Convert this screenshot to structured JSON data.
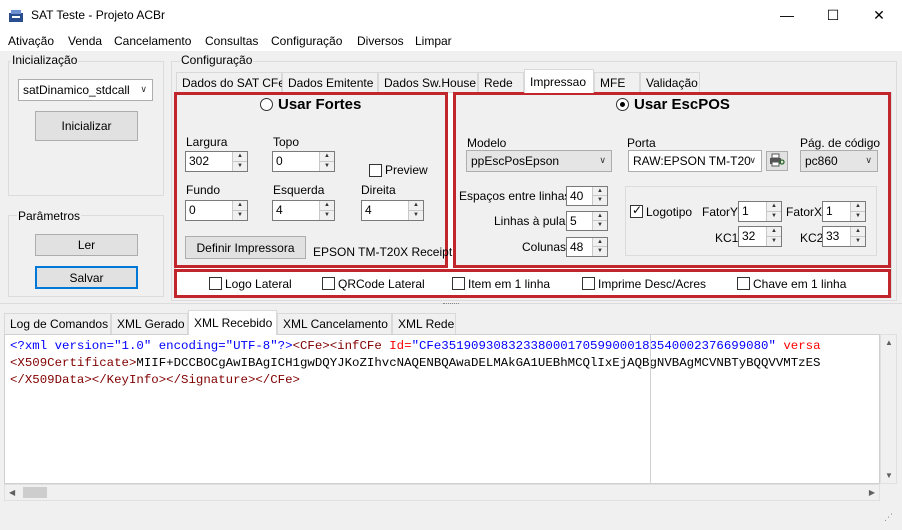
{
  "window": {
    "title": "SAT Teste - Projeto ACBr",
    "minimize": "—",
    "maximize": "☐",
    "close": "✕"
  },
  "menu": [
    "Ativação",
    "Venda",
    "Cancelamento",
    "Consultas",
    "Configuração",
    "Diversos",
    "Limpar"
  ],
  "init": {
    "group_label": "Inicialização",
    "library": "satDinamico_stdcall",
    "init_button": "Inicializar"
  },
  "params": {
    "group_label": "Parâmetros",
    "read_button": "Ler",
    "save_button": "Salvar"
  },
  "config": {
    "group_label": "Configuração",
    "tabs": [
      "Dados do SAT CFe",
      "Dados Emitente",
      "Dados Sw.House",
      "Rede",
      "Impressao",
      "MFE",
      "Validação"
    ],
    "active_tab": "Impressao"
  },
  "fortes": {
    "title": "Usar Fortes",
    "selected": false,
    "largura_label": "Largura",
    "largura": "302",
    "topo_label": "Topo",
    "topo": "0",
    "preview_label": "Preview",
    "preview_checked": false,
    "fundo_label": "Fundo",
    "fundo": "0",
    "esquerda_label": "Esquerda",
    "esquerda": "4",
    "direita_label": "Direita",
    "direita": "4",
    "define_button": "Definir Impressora",
    "printer_name": "EPSON TM-T20X Receipt"
  },
  "escpos": {
    "title": "Usar EscPOS",
    "selected": true,
    "modelo_label": "Modelo",
    "modelo": "ppEscPosEpson",
    "porta_label": "Porta",
    "porta": "RAW:EPSON TM-T20",
    "pagcod_label": "Pág. de código",
    "pagcod": "pc860",
    "espacos_label": "Espaços entre linhas",
    "espacos": "40",
    "linhas_label": "Linhas à pular",
    "linhas": "5",
    "colunas_label": "Colunas",
    "colunas": "48",
    "logotipo_label": "Logotipo",
    "logotipo_checked": true,
    "fatory_label": "FatorY",
    "fatory": "1",
    "fatorx_label": "FatorX",
    "fatorx": "1",
    "kc1_label": "KC1",
    "kc1": "32",
    "kc2_label": "KC2",
    "kc2": "33"
  },
  "options": [
    {
      "label": "Logo Lateral",
      "checked": false
    },
    {
      "label": "QRCode Lateral",
      "checked": false
    },
    {
      "label": "Item em 1 linha",
      "checked": false
    },
    {
      "label": "Imprime Desc/Acres",
      "checked": false
    },
    {
      "label": "Chave em 1 linha",
      "checked": false
    }
  ],
  "bottom_tabs": [
    "Log de Comandos",
    "XML Gerado",
    "XML Recebido",
    "XML Cancelamento",
    "XML Rede"
  ],
  "active_bottom_tab": "XML Recebido",
  "xml": {
    "l1_decl": "<?xml version=\"1.0\" encoding=\"UTF-8\"?>",
    "l1_cfe_open": "<CFe>",
    "l1_infcfe": "<infCFe",
    "l1_id_attr": " Id=",
    "l1_id_val": "\"CFe35190930832338000170599000183540002376699080\"",
    "l1_versa": " versa",
    "l2_open": "<X509Certificate>",
    "l2_text": "MIIF+DCCBOCgAwIBAgICH1gwDQYJKoZIhvcNAQENBQAwaDELMAkGA1UEBhMCQlIxEjAQBgNVBAgMCVNBTyBQQVVMTzES",
    "l3": "</X509Data></KeyInfo></Signature></CFe>"
  },
  "colors": {
    "highlight_border": "#c0262b",
    "xml_tag": "#800000",
    "xml_attr": "#ff0000",
    "xml_value": "#0000ff"
  }
}
